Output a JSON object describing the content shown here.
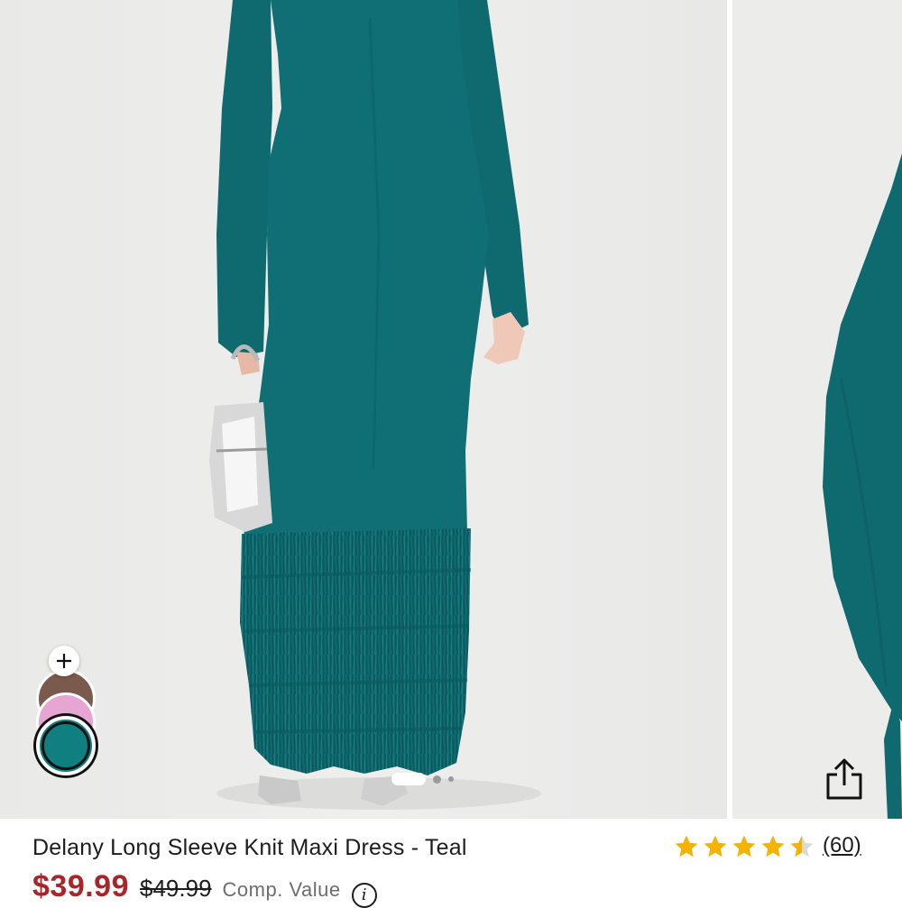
{
  "product": {
    "title": "Delany Long Sleeve Knit Maxi Dress - Teal",
    "price_sale": "$39.99",
    "price_original": "$49.99",
    "comp_value_label": "Comp. Value",
    "info_icon_glyph": "i",
    "rating": 4.5,
    "review_count": "(60)"
  },
  "swatches": {
    "more_glyph": "+",
    "colors": [
      {
        "name": "brown",
        "hex": "#7a5a4c"
      },
      {
        "name": "pink",
        "hex": "#e7a6d2"
      },
      {
        "name": "teal",
        "hex": "#0f7f80",
        "selected": true
      }
    ]
  },
  "gallery": {
    "current_slide": 1,
    "slide_count": 3
  },
  "icons": {
    "share": "share-icon",
    "add": "plus-icon",
    "info": "info-icon",
    "star": "star-icon"
  },
  "colors": {
    "sale_price": "#a7262a",
    "star": "#f5b301",
    "dress": "#0f6f74",
    "background": "#ececeb"
  }
}
